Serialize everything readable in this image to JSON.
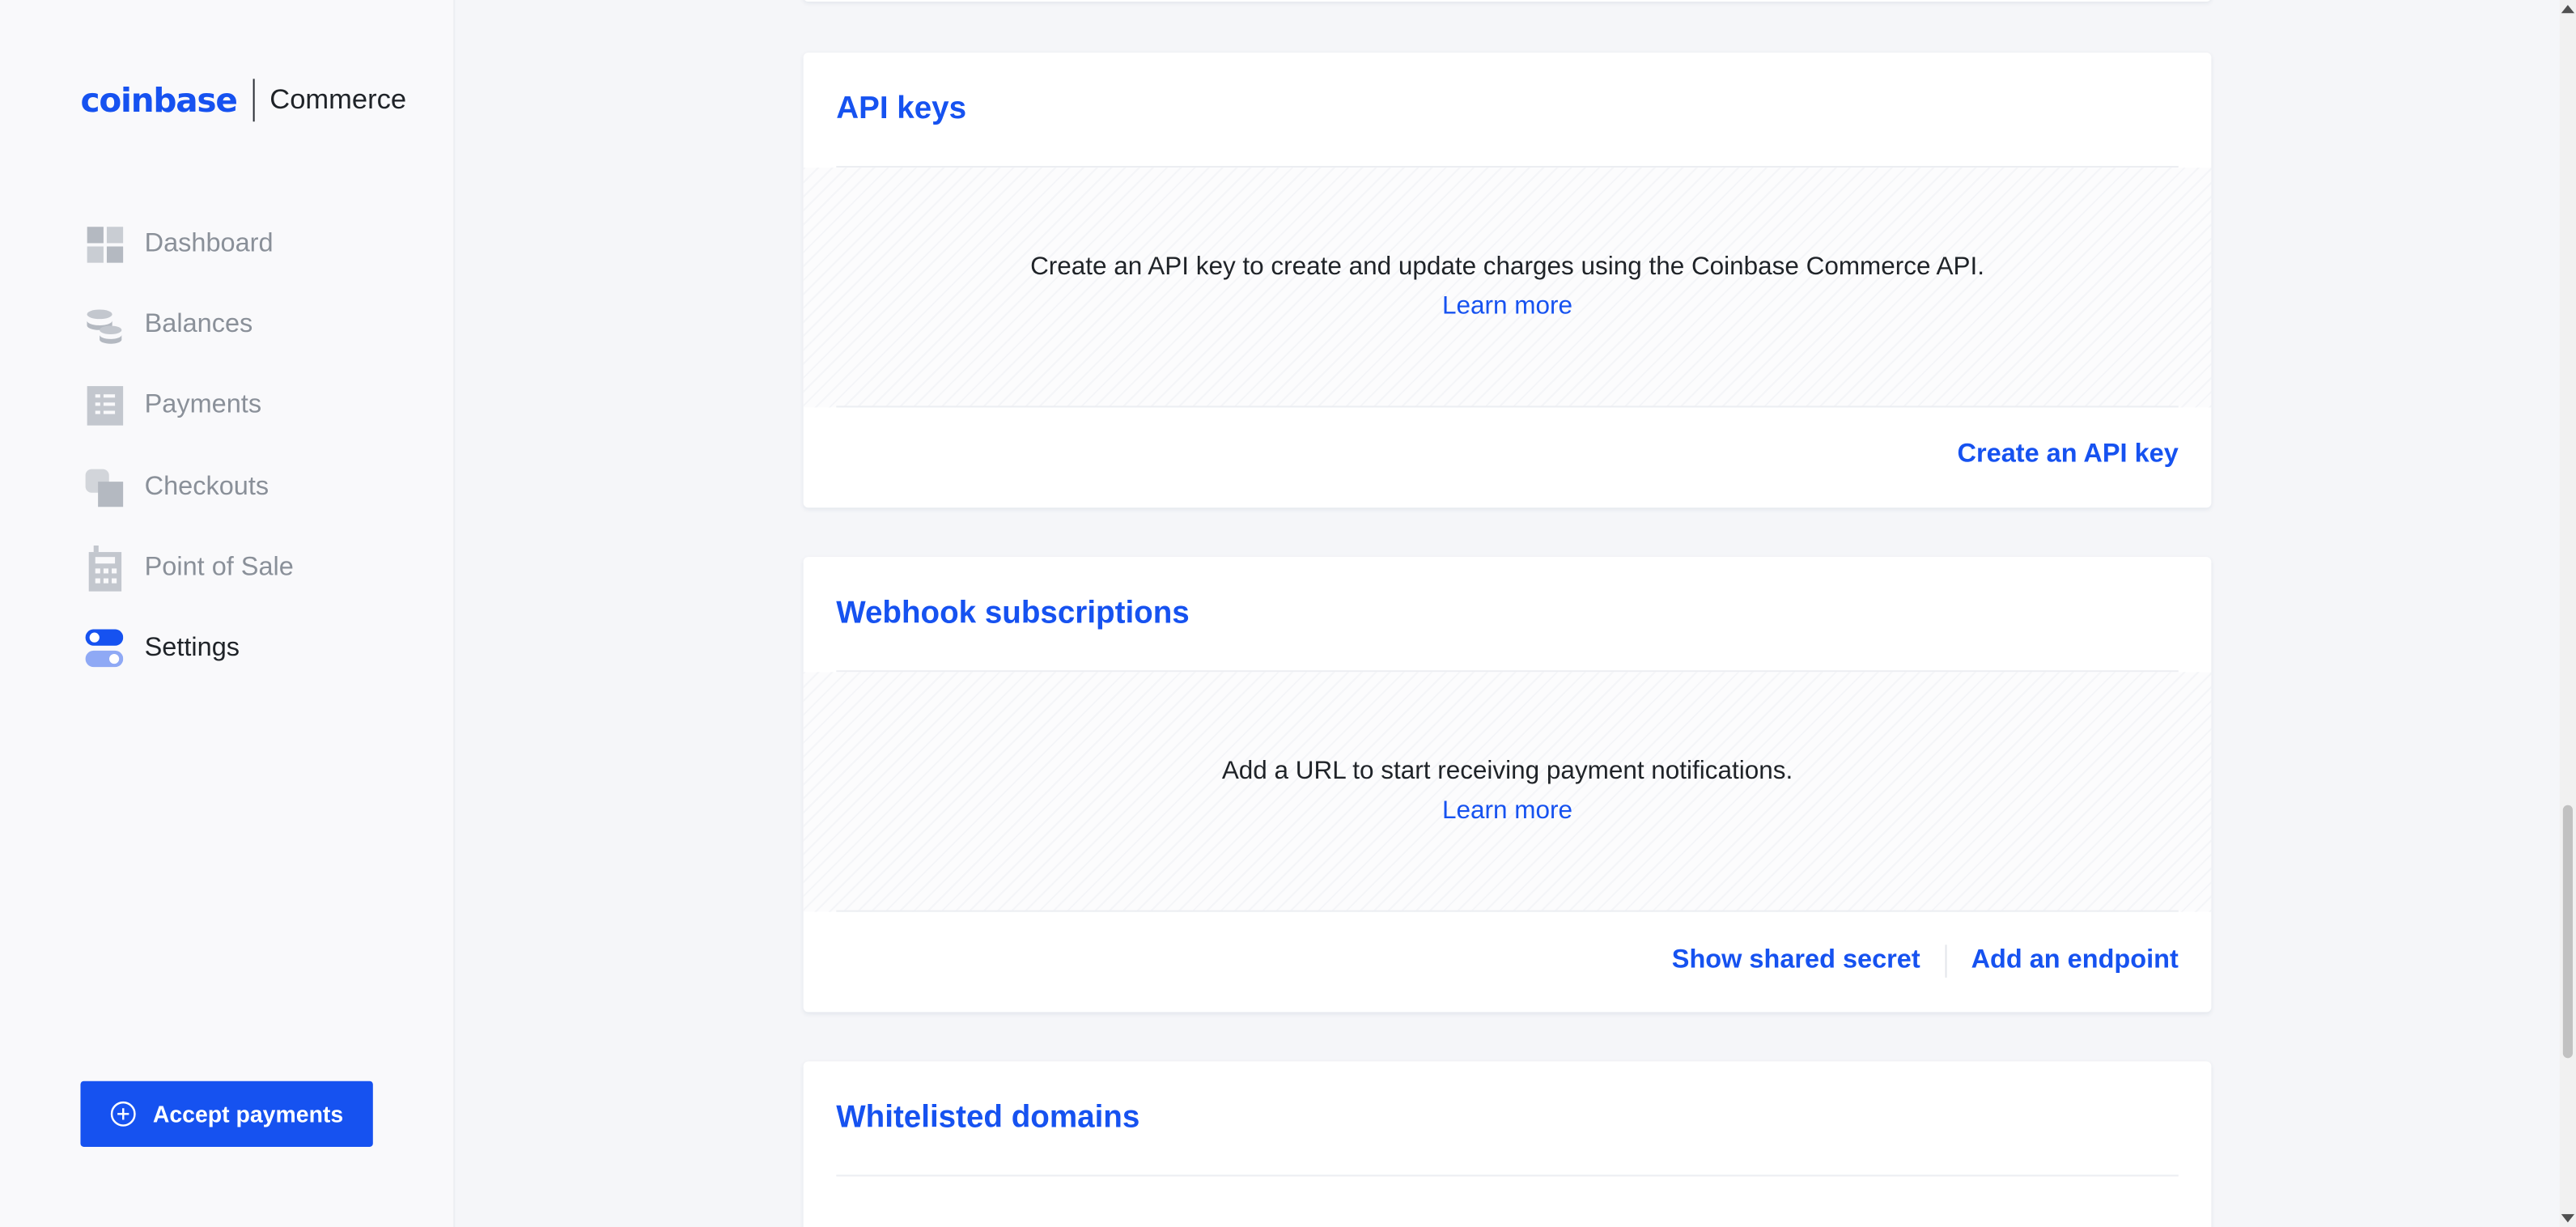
{
  "brand": {
    "logo_word": "coinbase",
    "product": "Commerce",
    "accent": "#1652f0"
  },
  "sidebar": {
    "items": [
      {
        "label": "Dashboard",
        "icon": "dashboard-grid-icon",
        "active": false
      },
      {
        "label": "Balances",
        "icon": "coin-stack-icon",
        "active": false
      },
      {
        "label": "Payments",
        "icon": "receipt-list-icon",
        "active": false
      },
      {
        "label": "Checkouts",
        "icon": "checkout-squares-icon",
        "active": false
      },
      {
        "label": "Point of Sale",
        "icon": "calculator-icon",
        "active": false
      },
      {
        "label": "Settings",
        "icon": "toggle-switches-icon",
        "active": true
      }
    ],
    "accept_payments_label": "Accept payments"
  },
  "main": {
    "api_keys": {
      "title": "API keys",
      "message": "Create an API key to create and update charges using the Coinbase Commerce API.",
      "learn_more": "Learn more",
      "actions": [
        "Create an API key"
      ]
    },
    "webhooks": {
      "title": "Webhook subscriptions",
      "message": "Add a URL to start receiving payment notifications.",
      "learn_more": "Learn more",
      "actions": [
        "Show shared secret",
        "Add an endpoint"
      ]
    },
    "whitelisted_domains": {
      "title": "Whitelisted domains"
    }
  }
}
